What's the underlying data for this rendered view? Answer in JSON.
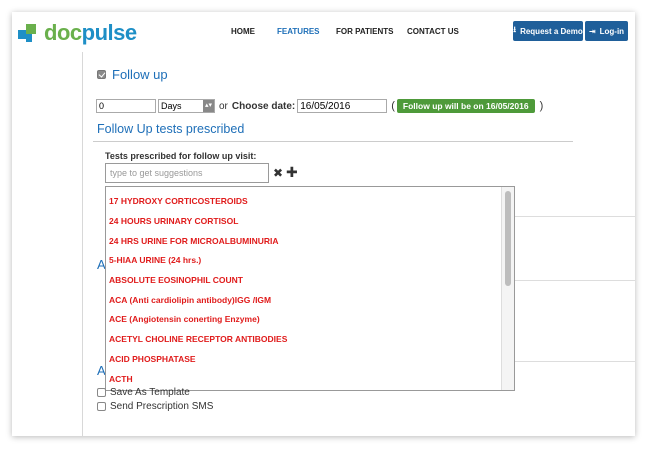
{
  "header": {
    "logo_doc": "doc",
    "logo_pulse": "pulse",
    "nav": [
      "HOME",
      "FEATURES",
      "FOR PATIENTS",
      "CONTACT US"
    ],
    "active_nav": "FEATURES",
    "demo_label": "Request a Demo",
    "login_label": "Log-in"
  },
  "followup": {
    "checkbox_label": "Follow up",
    "days_value": "0",
    "unit_value": "Days",
    "or_text": "or",
    "choose_date_label": "Choose date:",
    "date_value": "16/05/2016",
    "paren_open": "(",
    "paren_close": ")",
    "badge_text": "Follow up will be on 16/05/2016"
  },
  "tests": {
    "section_title": "Follow Up tests prescribed",
    "field_label": "Tests prescribed for follow up visit:",
    "placeholder": "type to get suggestions",
    "clear_symbol": "✖",
    "add_symbol": "✚"
  },
  "suggestions": [
    "17 HYDROXY CORTICOSTEROIDS",
    "24 HOURS URINARY CORTISOL",
    "24 HRS URINE FOR MICROALBUMINURIA",
    "5-HIAA URINE (24 hrs.)",
    "ABSOLUTE EOSINOPHIL COUNT",
    "ACA (Anti cardiolipin antibody)IGG /IGM",
    "ACE (Angiotensin conerting Enzyme)",
    "ACETYL CHOLINE RECEPTOR ANTIBODIES",
    "ACID PHOSPHATASE",
    "ACTH"
  ],
  "background": {
    "letter_1": "A",
    "letter_2": "A"
  },
  "bottom": {
    "save_template": "Save As Template",
    "send_sms": "Send Prescription SMS"
  },
  "colors": {
    "brand_blue": "#1e8fc6",
    "brand_green": "#6ab04c",
    "suggestion_red": "#e01b1b",
    "badge_green": "#4e9a3a"
  }
}
